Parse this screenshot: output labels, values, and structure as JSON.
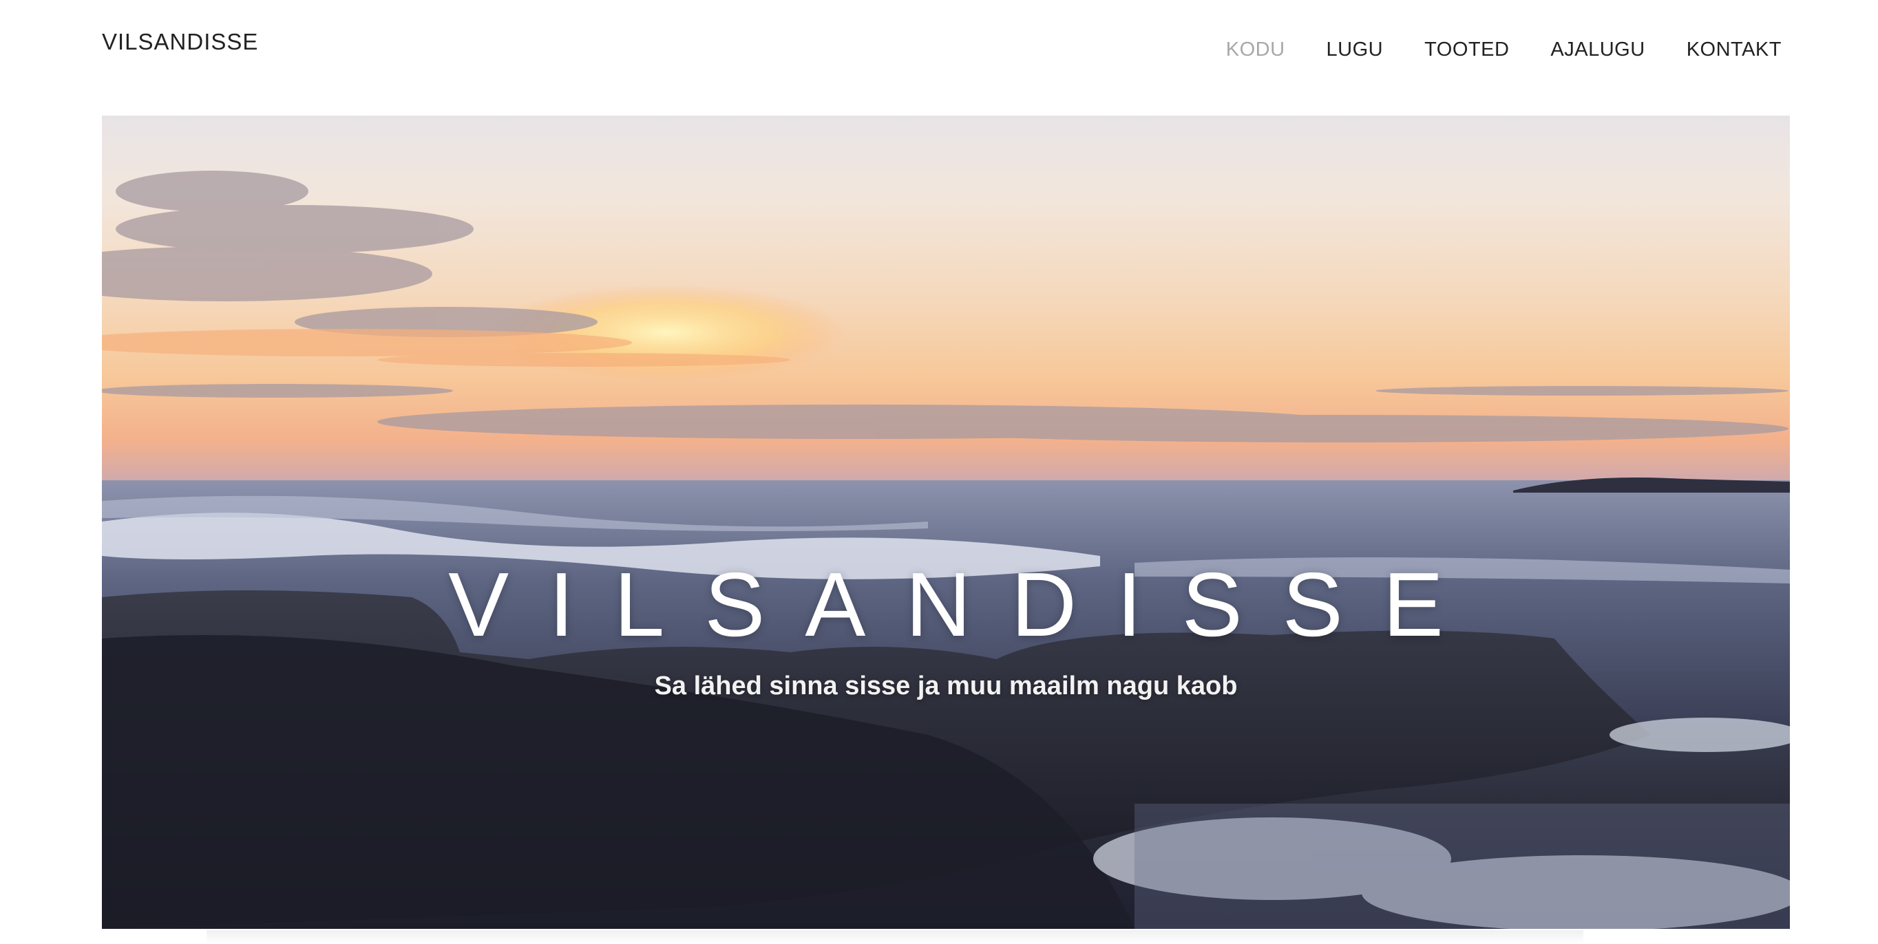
{
  "header": {
    "logo": "VILSANDISSE",
    "nav": [
      {
        "label": "KODU",
        "active": true
      },
      {
        "label": "LUGU",
        "active": false
      },
      {
        "label": "TOOTED",
        "active": false
      },
      {
        "label": "AJALUGU",
        "active": false
      },
      {
        "label": "KONTAKT",
        "active": false
      }
    ]
  },
  "hero": {
    "title": "VILSANDISSE",
    "subtitle": "Sa lähed sinna sisse ja muu maailm nagu kaob"
  },
  "colors": {
    "nav_active": "#a8a8a8",
    "text": "#222222",
    "hero_text": "#ffffff"
  }
}
